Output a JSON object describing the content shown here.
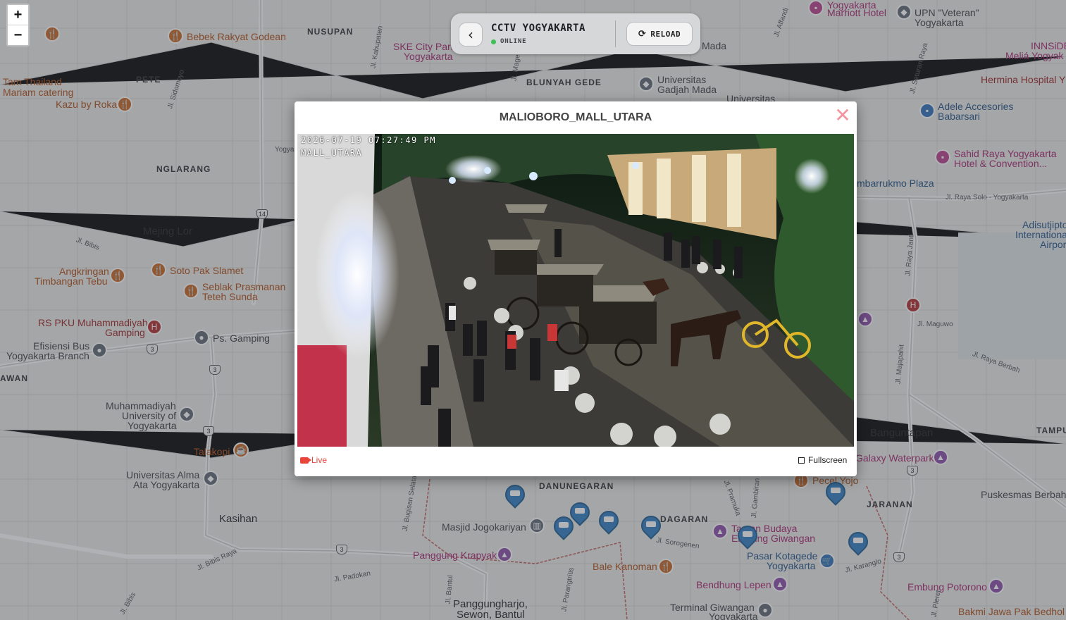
{
  "header": {
    "title": "CCTV YOGYAKARTA",
    "status": "ONLINE",
    "reload_label": "RELOAD",
    "back_icon": "chevron-left-icon",
    "reload_icon": "refresh-icon"
  },
  "zoom": {
    "in": "+",
    "out": "−"
  },
  "modal": {
    "title": "MALIOBORO_MALL_UTARA",
    "close_glyph": "✕",
    "timestamp": "2026-07-19 07:27:49 PM",
    "camera_label": "MALL_UTARA",
    "live_label": "Live",
    "fullscreen_label": "Fullscreen"
  },
  "map": {
    "places": [
      {
        "text": "Bebek Rakyat Godean",
        "kind": "poi"
      },
      {
        "text": "NUSUPAN",
        "kind": "hood"
      },
      {
        "text": "PETE",
        "kind": "hood"
      },
      {
        "text": "Tam Thailand",
        "kind": "poi"
      },
      {
        "text": "Mariam catering",
        "kind": "poi"
      },
      {
        "text": "Kazu by Roka",
        "kind": "poi"
      },
      {
        "text": "NGLARANG",
        "kind": "hood"
      },
      {
        "text": "Mejing Lor",
        "kind": "town"
      },
      {
        "text": "Angkringan",
        "kind": "poi"
      },
      {
        "text": "Timbangan Tebu",
        "kind": "poi"
      },
      {
        "text": "Soto Pak Slamet",
        "kind": "poi"
      },
      {
        "text": "Seblak Prasmanan",
        "kind": "poi"
      },
      {
        "text": "Teteh Sunda",
        "kind": "poi"
      },
      {
        "text": "RS PKU Muhammadiyah",
        "kind": "hosp"
      },
      {
        "text": "Gamping",
        "kind": "hosp"
      },
      {
        "text": "Ps. Gamping",
        "kind": "dark"
      },
      {
        "text": "Efisiensi Bus",
        "kind": "dark"
      },
      {
        "text": "Yogyakarta Branch",
        "kind": "dark"
      },
      {
        "text": "AWAN",
        "kind": "hood"
      },
      {
        "text": "Muhammadiyah",
        "kind": "dark"
      },
      {
        "text": "University of",
        "kind": "dark"
      },
      {
        "text": "Yogyakarta",
        "kind": "dark"
      },
      {
        "text": "Talakopi",
        "kind": "poi"
      },
      {
        "text": "Universitas Alma",
        "kind": "dark"
      },
      {
        "text": "Ata Yogyakarta",
        "kind": "dark"
      },
      {
        "text": "Kasihan",
        "kind": "town"
      },
      {
        "text": "SKE City Park",
        "kind": "pink"
      },
      {
        "text": "Yogyakarta",
        "kind": "pink"
      },
      {
        "text": "BLUNYAH GEDE",
        "kind": "hood"
      },
      {
        "text": "Universitas",
        "kind": "dark"
      },
      {
        "text": "Gadjah Mada",
        "kind": "dark"
      },
      {
        "text": "Universitas",
        "kind": "dark"
      },
      {
        "text": "Mada",
        "kind": "dark"
      },
      {
        "text": "Yogyakarta",
        "kind": "pink"
      },
      {
        "text": "Marriott Hotel",
        "kind": "pink"
      },
      {
        "text": "UPN \"Veteran\"",
        "kind": "dark"
      },
      {
        "text": "Yogyakarta",
        "kind": "dark"
      },
      {
        "text": "INNSiDE",
        "kind": "pink"
      },
      {
        "text": "Meliá Yogyak",
        "kind": "pink"
      },
      {
        "text": "Hermina Hospital Y",
        "kind": "hosp"
      },
      {
        "text": "Adele Accesories",
        "kind": "blue"
      },
      {
        "text": "Babarsari",
        "kind": "blue"
      },
      {
        "text": "Sahid Raya Yogyakarta",
        "kind": "pink"
      },
      {
        "text": "Hotel & Convention...",
        "kind": "pink"
      },
      {
        "text": "mbarrukmo Plaza",
        "kind": "blue"
      },
      {
        "text": "Adisutjipto",
        "kind": "blue"
      },
      {
        "text": "Internationa",
        "kind": "blue"
      },
      {
        "text": "Airpor",
        "kind": "blue"
      },
      {
        "text": "Banguntapan",
        "kind": "town"
      },
      {
        "text": "Galaxy Waterpark",
        "kind": "pink"
      },
      {
        "text": "TAMPU",
        "kind": "hood"
      },
      {
        "text": "Pecel Yojo",
        "kind": "poi"
      },
      {
        "text": "JARANAN",
        "kind": "hood"
      },
      {
        "text": "Puskesmas Berbah",
        "kind": "dark"
      },
      {
        "text": "DANUNEGARAN",
        "kind": "hood"
      },
      {
        "text": "DAGARAN",
        "kind": "hood"
      },
      {
        "text": "Masjid Jogokariyan",
        "kind": "dark"
      },
      {
        "text": "Taman Budaya",
        "kind": "pink"
      },
      {
        "text": "Embung Giwangan",
        "kind": "pink"
      },
      {
        "text": "Panggung Krapyak",
        "kind": "pink"
      },
      {
        "text": "Pasar Kotagede",
        "kind": "blue"
      },
      {
        "text": "Yogyakarta",
        "kind": "blue"
      },
      {
        "text": "Bale Kanoman",
        "kind": "poi"
      },
      {
        "text": "Bendhung Lepen",
        "kind": "pink"
      },
      {
        "text": "Embung Potorono",
        "kind": "pink"
      },
      {
        "text": "Panggungharjo,",
        "kind": "town"
      },
      {
        "text": "Sewon, Bantul",
        "kind": "town"
      },
      {
        "text": "Terminal Giwangan",
        "kind": "dark"
      },
      {
        "text": "Yogyakarta",
        "kind": "dark"
      },
      {
        "text": "Bakmi Jawa Pak Bedhol",
        "kind": "poi"
      }
    ],
    "roads": [
      "Jl. Sidomoyo",
      "Jl. Kabupaten",
      "Jl. Magelang",
      "Jl. Affandi",
      "Jl. Seturan Raya",
      "Jl. Bibis",
      "Jl. Raya Solo - Yogyakarta",
      "Jl. Raya Janti",
      "Jl. Maguwo",
      "Jl. Majapahit",
      "Jl. Raya Berbah",
      "Jl. Bugisan Selatan",
      "Jl. Bibis Raya",
      "Jl. Padokan",
      "Jl. Bantul",
      "Jl. Parangtritis",
      "Jl. Pramuka",
      "Jl. Gambiran",
      "Jl. Sorogenen",
      "Jl. Karanglo",
      "Jl. Pleret",
      "Yogya",
      "Jl. Bibis"
    ],
    "route_numbers": [
      "14",
      "3",
      "3",
      "3",
      "3",
      "3",
      "3"
    ]
  },
  "colors": {
    "accent_live": "#e8453c",
    "status_online": "#3fbf55",
    "camera_pin": "#2b7bbf",
    "close": "#f4949e"
  }
}
